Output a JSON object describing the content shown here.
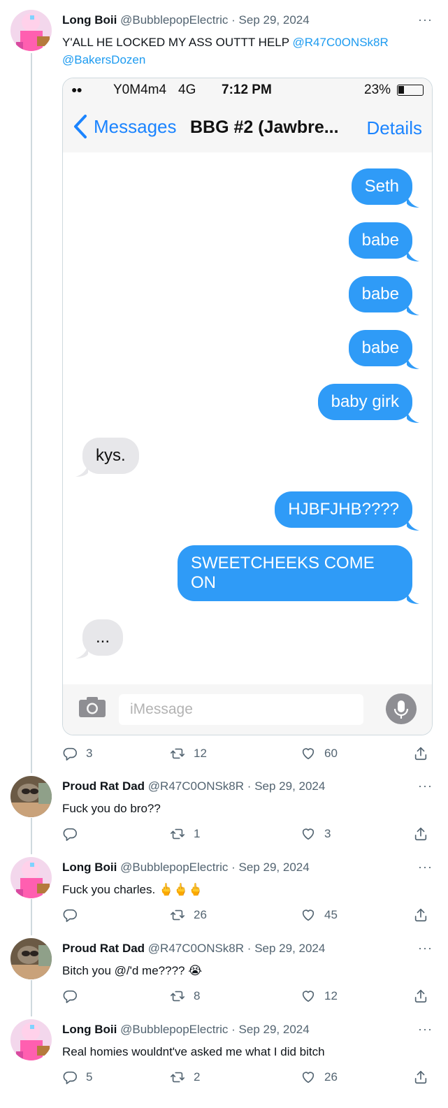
{
  "tweets": [
    {
      "name": "Long Boii",
      "handle": "@BubblepopElectric",
      "date": "Sep 29, 2024",
      "text_main": "Y'ALL HE LOCKED MY ASS OUTTT HELP ",
      "text_mention1": "@R47C0ONSk8R",
      "text_mention2": "@BakersDozen",
      "stats": {
        "replies": "3",
        "retweets": "12",
        "likes": "60"
      }
    },
    {
      "name": "Proud Rat Dad",
      "handle": "@R47C0ONSk8R",
      "date": "Sep 29, 2024",
      "text": "Fuck you do bro??",
      "stats": {
        "replies": "",
        "retweets": "1",
        "likes": "3"
      }
    },
    {
      "name": "Long Boii",
      "handle": "@BubblepopElectric",
      "date": "Sep 29, 2024",
      "text": "Fuck you charles. 🖕🖕🖕",
      "stats": {
        "replies": "",
        "retweets": "26",
        "likes": "45"
      }
    },
    {
      "name": "Proud Rat Dad",
      "handle": "@R47C0ONSk8R",
      "date": "Sep 29, 2024",
      "text": "Bitch you @/'d me???? 😭",
      "stats": {
        "replies": "",
        "retweets": "8",
        "likes": "12"
      }
    },
    {
      "name": "Long Boii",
      "handle": "@BubblepopElectric",
      "date": "Sep 29, 2024",
      "text": "Real homies wouldnt've asked me what I did bitch",
      "stats": {
        "replies": "5",
        "retweets": "2",
        "likes": "26"
      }
    }
  ],
  "separator": "·",
  "more_glyph": "···",
  "imessage": {
    "carrier": "Y0M4m4",
    "network": "4G",
    "time": "7:12 PM",
    "battery": "23%",
    "back_label": "Messages",
    "title": "BBG #2 (Jawbre...",
    "details_label": "Details",
    "input_placeholder": "iMessage",
    "messages": [
      {
        "dir": "out",
        "text": "Seth"
      },
      {
        "dir": "out",
        "text": "babe"
      },
      {
        "dir": "out",
        "text": "babe"
      },
      {
        "dir": "out",
        "text": "babe"
      },
      {
        "dir": "out",
        "text": "baby girk"
      },
      {
        "dir": "in",
        "text": "kys."
      },
      {
        "dir": "out",
        "text": "HJBFJHB????"
      },
      {
        "dir": "out",
        "text": "SWEETCHEEKS COME ON"
      },
      {
        "dir": "in",
        "text": "..."
      }
    ]
  },
  "colors": {
    "link": "#1d9bf0",
    "imessage_blue": "#2f9bf7",
    "ios_blue": "#1b84ff",
    "muted": "#536471"
  }
}
